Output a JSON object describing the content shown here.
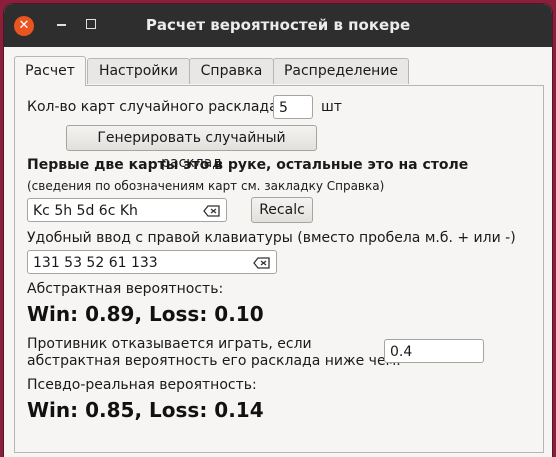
{
  "window": {
    "title": "Расчет вероятностей в покере"
  },
  "tabs": [
    {
      "label": "Расчет"
    },
    {
      "label": "Настройки"
    },
    {
      "label": "Справка"
    },
    {
      "label": "Распределение"
    }
  ],
  "calc": {
    "random_count_label": "Кол-во карт случайного расклада:",
    "random_count_value": "5",
    "random_count_unit": "шт",
    "generate_button": "Генерировать случайный расклад",
    "hint_bold": "Первые две карты это в руке, остальные это на столе",
    "hint_small": "(сведения по обозначениям карт см. закладку Справка)",
    "cards_value": "Kc 5h 5d 6c Kh",
    "recalc_button": "Recalc",
    "numpad_label": "Удобный ввод с правой клавиатуры (вместо пробела м.б. + или -)",
    "numpad_value": "131 53 52 61 133",
    "abstract_label": "Абстрактная вероятность:",
    "abstract_result": "Win: 0.89,  Loss: 0.10",
    "opponent_label_1": "Противник отказывается играть, если",
    "opponent_label_2": "абстрактная вероятность его расклада ниже чем:",
    "opponent_threshold": "0.4",
    "pseudo_label": "Псевдо-реальная вероятность:",
    "pseudo_result": "Win: 0.85,  Loss: 0.14"
  },
  "colors": {
    "close_button": "#e95420",
    "titlebar": "#2e2e2e",
    "desktop": "#8a1f3c"
  },
  "icons": {
    "close": "close-icon",
    "minimize": "minimize-icon",
    "maximize": "maximize-icon",
    "clear": "clear-text-icon"
  }
}
